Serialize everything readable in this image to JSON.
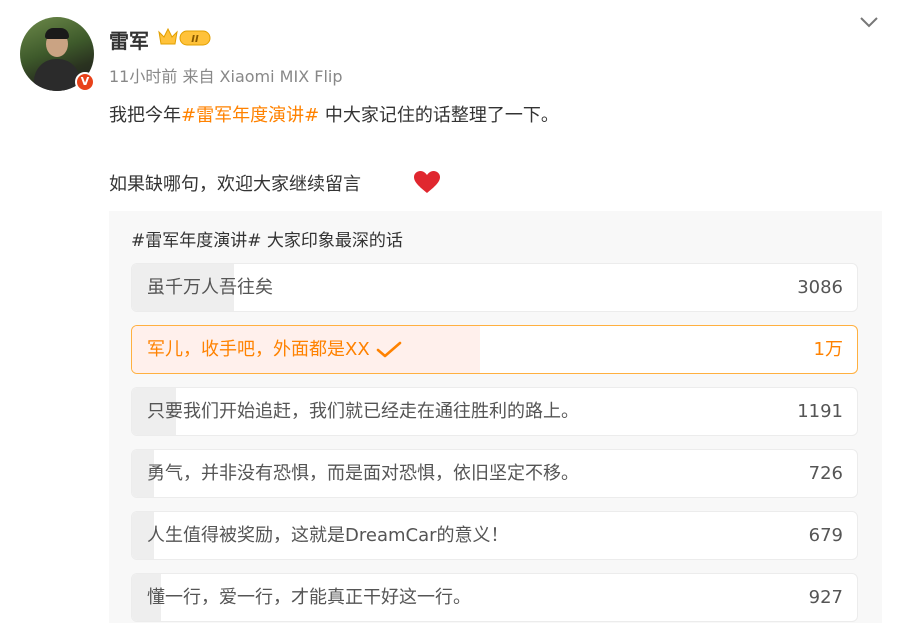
{
  "post": {
    "author": "雷军",
    "time": "11小时前",
    "source": "来自 Xiaomi MIX Flip",
    "text_line1_before": "我把今年",
    "text_line1_topic": "#雷军年度演讲#",
    "text_line1_after": " 中大家记住的话整理了一下。",
    "text_line2": "如果缺哪句，欢迎大家继续留言",
    "icons": [
      "avatar",
      "verified-badge-icon",
      "crown-level-icon",
      "chevron-down-icon",
      "heart-icon",
      "checkmark-icon"
    ],
    "colors": {
      "accent": "#ff8200",
      "verified": "#e8421a",
      "heart": "#e0272f"
    }
  },
  "poll": {
    "title": "#雷军年度演讲# 大家印象最深的话",
    "options": [
      {
        "label": "虽千万人吾往矣",
        "count": "3086",
        "fill": 0.14,
        "selected": false
      },
      {
        "label": "军儿，收手吧，外面都是XX",
        "count": "1万",
        "fill": 0.48,
        "selected": true
      },
      {
        "label": "只要我们开始追赶，我们就已经走在通往胜利的路上。",
        "count": "1191",
        "fill": 0.06,
        "selected": false
      },
      {
        "label": "勇气，并非没有恐惧，而是面对恐惧，依旧坚定不移。",
        "count": "726",
        "fill": 0.03,
        "selected": false
      },
      {
        "label": "人生值得被奖励，这就是DreamCar的意义！",
        "count": "679",
        "fill": 0.03,
        "selected": false
      },
      {
        "label": "懂一行，爱一行，才能真正干好这一行。",
        "count": "927",
        "fill": 0.04,
        "selected": false
      }
    ]
  }
}
